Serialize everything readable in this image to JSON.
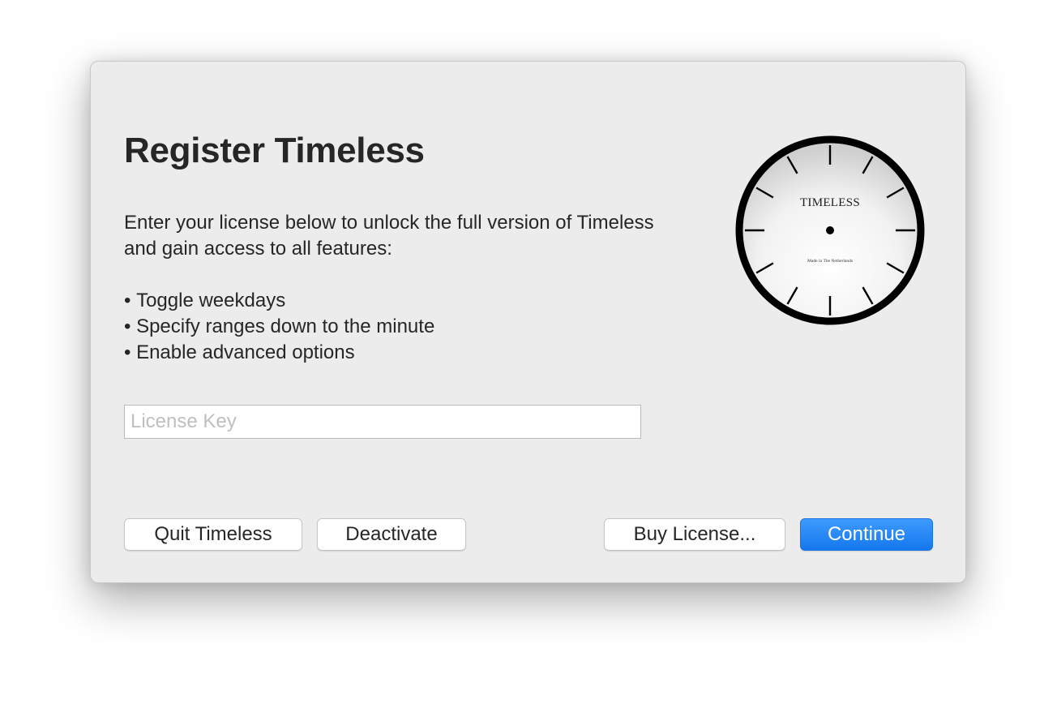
{
  "dialog": {
    "title": "Register Timeless",
    "description": "Enter your license below to unlock the full version of Timeless and gain access to all features:",
    "features": [
      "Toggle weekdays",
      "Specify ranges down to the minute",
      "Enable advanced options"
    ],
    "license_input": {
      "placeholder": "License Key",
      "value": ""
    },
    "buttons": {
      "quit": "Quit Timeless",
      "deactivate": "Deactivate",
      "buy": "Buy License...",
      "continue": "Continue"
    }
  },
  "clock": {
    "brand": "TIMELESS",
    "caption": "Made in The Netherlands"
  },
  "colors": {
    "window_bg": "#ececec",
    "text": "#262626",
    "accent": "#1a7ef5",
    "placeholder": "#bfbfbf"
  }
}
